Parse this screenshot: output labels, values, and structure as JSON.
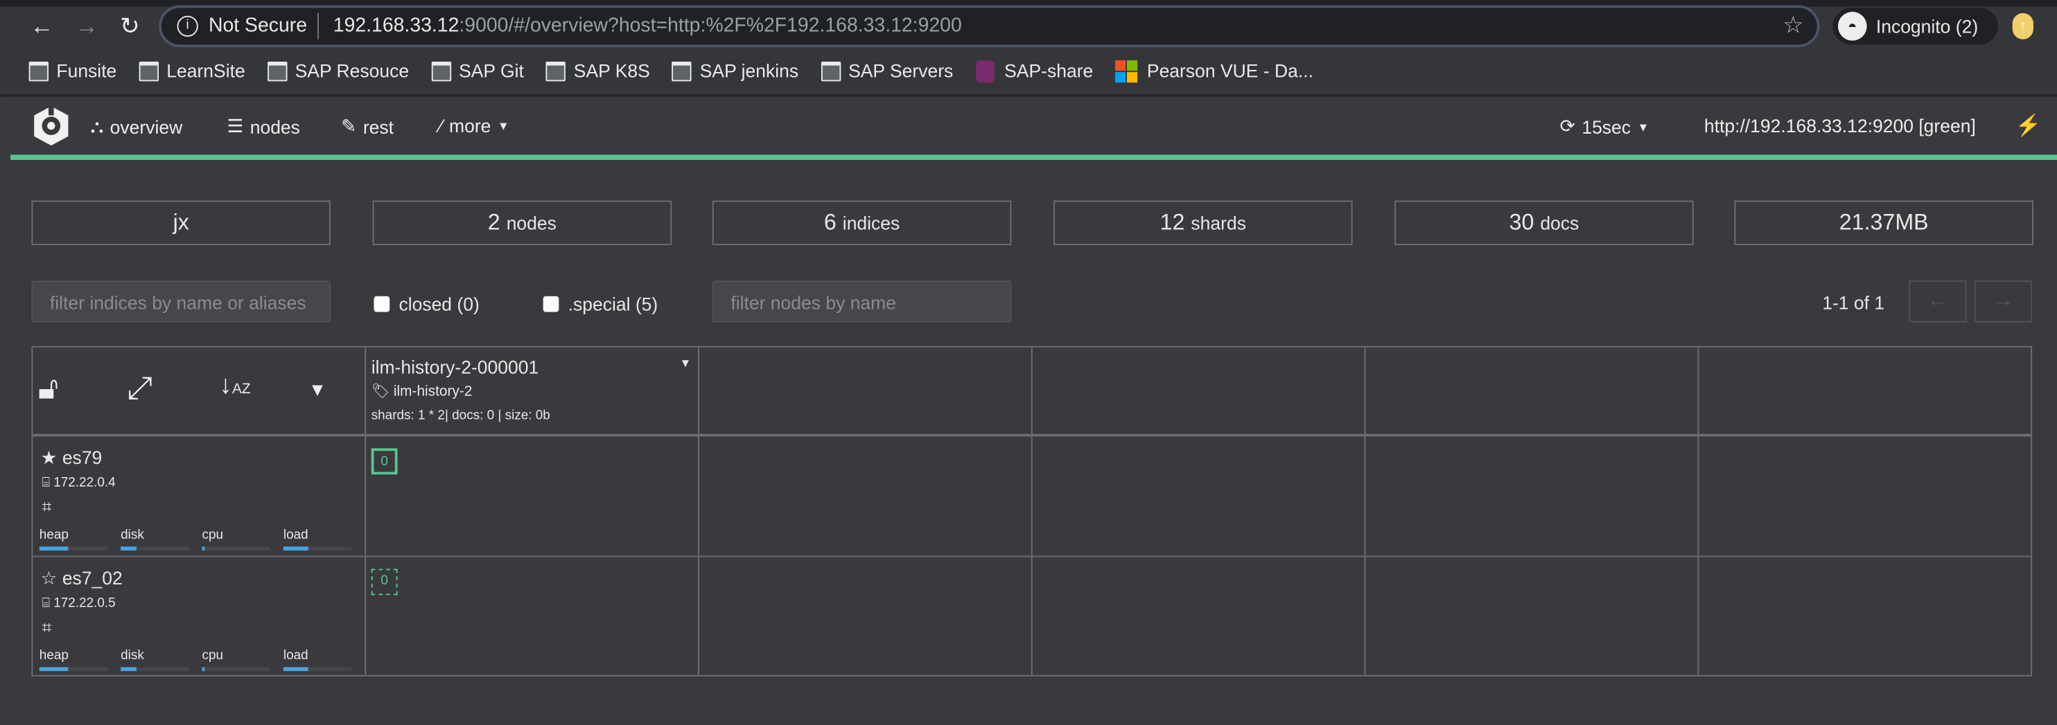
{
  "browser": {
    "security": "Not Secure",
    "url_host": "192.168.33.12",
    "url_rest": ":9000/#/overview?host=http:%2F%2F192.168.33.12:9200",
    "profile": "Incognito (2)",
    "bookmarks": [
      {
        "label": "Funsite",
        "icon": "folder-icon"
      },
      {
        "label": "LearnSite",
        "icon": "folder-icon"
      },
      {
        "label": "SAP Resouce",
        "icon": "folder-icon"
      },
      {
        "label": "SAP Git",
        "icon": "folder-icon"
      },
      {
        "label": "SAP K8S",
        "icon": "folder-icon"
      },
      {
        "label": "SAP jenkins",
        "icon": "folder-icon"
      },
      {
        "label": "SAP Servers",
        "icon": "folder-icon"
      },
      {
        "label": "SAP-share",
        "icon": "sap-share-icon"
      },
      {
        "label": "Pearson VUE - Da...",
        "icon": "microsoft-icon"
      }
    ]
  },
  "nav": {
    "overview": "overview",
    "nodes": "nodes",
    "rest": "rest",
    "more": "more",
    "refresh": "15sec",
    "cluster": "http://192.168.33.12:9200 [green]",
    "health_color": "#5bc590"
  },
  "stats": {
    "cluster_name": "jx",
    "nodes_n": "2",
    "nodes_l": "nodes",
    "indices_n": "6",
    "indices_l": "indices",
    "shards_n": "12",
    "shards_l": "shards",
    "docs_n": "30",
    "docs_l": "docs",
    "size": "21.37MB"
  },
  "filters": {
    "indices_placeholder": "filter indices by name or aliases",
    "closed": "closed (0)",
    "special": ".special (5)",
    "nodes_placeholder": "filter nodes by name",
    "pagination": "1-1 of 1",
    "prev": "←",
    "next": "→"
  },
  "index": {
    "name": "ilm-history-2-000001",
    "alias": "ilm-history-2",
    "info": "shards: 1 * 2| docs: 0 | size: 0b"
  },
  "nodes": [
    {
      "name": "es79",
      "ip": "172.22.0.4",
      "master": true,
      "shard": "0",
      "shard_type": "primary",
      "metrics": {
        "heap": 0.43,
        "disk": 0.23,
        "cpu": 0.03,
        "load": 0.36
      }
    },
    {
      "name": "es7_02",
      "ip": "172.22.0.5",
      "master": false,
      "shard": "0",
      "shard_type": "replica",
      "metrics": {
        "heap": 0.43,
        "disk": 0.23,
        "cpu": 0.03,
        "load": 0.36
      }
    }
  ],
  "metric_labels": {
    "heap": "heap",
    "disk": "disk",
    "cpu": "cpu",
    "load": "load"
  }
}
